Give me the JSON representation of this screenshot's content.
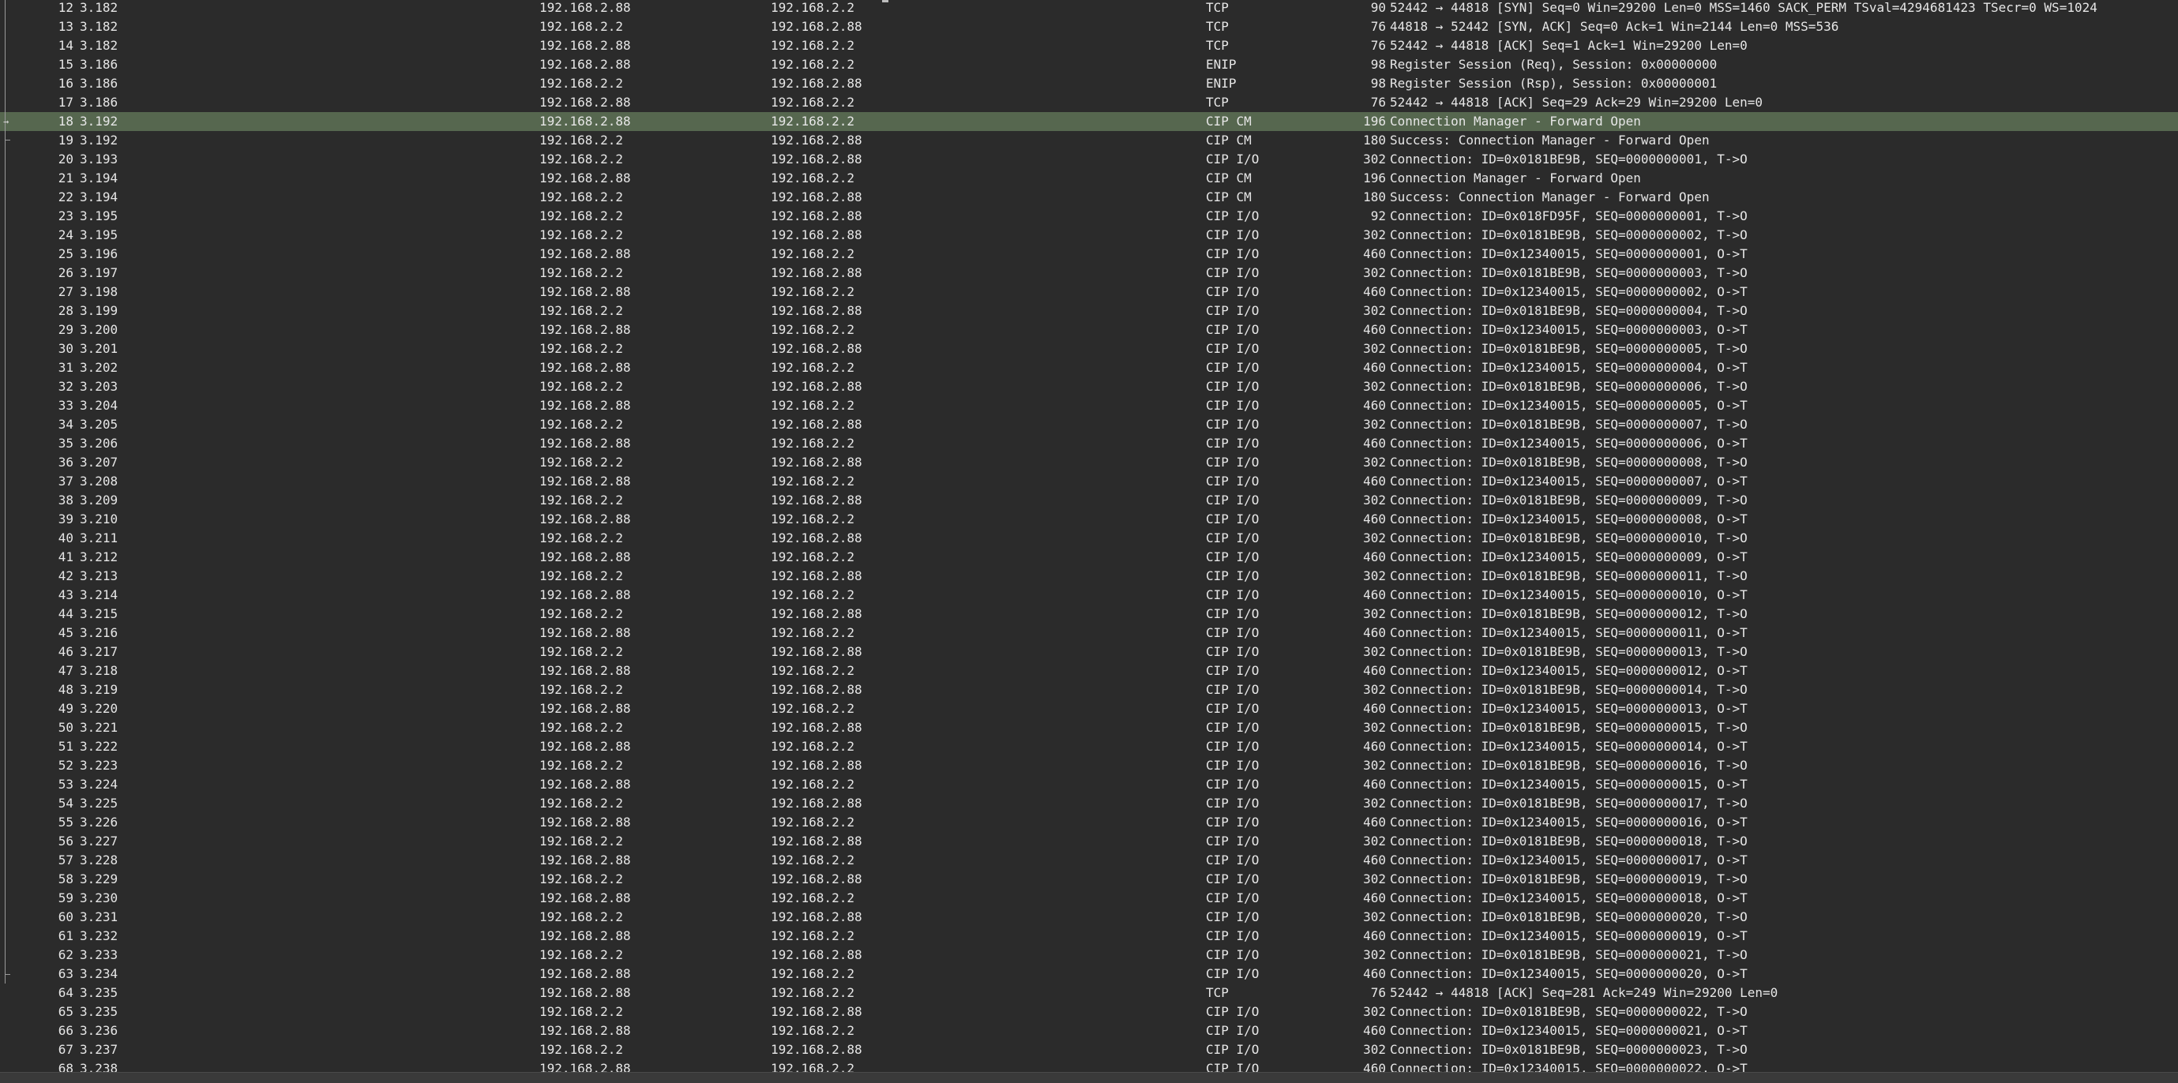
{
  "packets": [
    {
      "no": "12",
      "time": "3.182",
      "src": "192.168.2.88",
      "dst": "192.168.2.2",
      "proto": "TCP",
      "len": "90",
      "info": "52442 → 44818 [SYN] Seq=0 Win=29200 Len=0 MSS=1460 SACK_PERM TSval=4294681423 TSecr=0 WS=1024",
      "selected": false
    },
    {
      "no": "13",
      "time": "3.182",
      "src": "192.168.2.2",
      "dst": "192.168.2.88",
      "proto": "TCP",
      "len": "76",
      "info": "44818 → 52442 [SYN, ACK] Seq=0 Ack=1 Win=2144 Len=0 MSS=536",
      "selected": false
    },
    {
      "no": "14",
      "time": "3.182",
      "src": "192.168.2.88",
      "dst": "192.168.2.2",
      "proto": "TCP",
      "len": "76",
      "info": "52442 → 44818 [ACK] Seq=1 Ack=1 Win=29200 Len=0",
      "selected": false
    },
    {
      "no": "15",
      "time": "3.186",
      "src": "192.168.2.88",
      "dst": "192.168.2.2",
      "proto": "ENIP",
      "len": "98",
      "info": "Register Session (Req), Session: 0x00000000",
      "selected": false
    },
    {
      "no": "16",
      "time": "3.186",
      "src": "192.168.2.2",
      "dst": "192.168.2.88",
      "proto": "ENIP",
      "len": "98",
      "info": "Register Session (Rsp), Session: 0x00000001",
      "selected": false
    },
    {
      "no": "17",
      "time": "3.186",
      "src": "192.168.2.88",
      "dst": "192.168.2.2",
      "proto": "TCP",
      "len": "76",
      "info": "52442 → 44818 [ACK] Seq=29 Ack=29 Win=29200 Len=0",
      "selected": false
    },
    {
      "no": "18",
      "time": "3.192",
      "src": "192.168.2.88",
      "dst": "192.168.2.2",
      "proto": "CIP CM",
      "len": "196",
      "info": "Connection Manager - Forward Open",
      "selected": true
    },
    {
      "no": "19",
      "time": "3.192",
      "src": "192.168.2.2",
      "dst": "192.168.2.88",
      "proto": "CIP CM",
      "len": "180",
      "info": "Success: Connection Manager - Forward Open",
      "selected": false
    },
    {
      "no": "20",
      "time": "3.193",
      "src": "192.168.2.2",
      "dst": "192.168.2.88",
      "proto": "CIP I/O",
      "len": "302",
      "info": "Connection: ID=0x0181BE9B, SEQ=0000000001, T->O",
      "selected": false
    },
    {
      "no": "21",
      "time": "3.194",
      "src": "192.168.2.88",
      "dst": "192.168.2.2",
      "proto": "CIP CM",
      "len": "196",
      "info": "Connection Manager - Forward Open",
      "selected": false
    },
    {
      "no": "22",
      "time": "3.194",
      "src": "192.168.2.2",
      "dst": "192.168.2.88",
      "proto": "CIP CM",
      "len": "180",
      "info": "Success: Connection Manager - Forward Open",
      "selected": false
    },
    {
      "no": "23",
      "time": "3.195",
      "src": "192.168.2.2",
      "dst": "192.168.2.88",
      "proto": "CIP I/O",
      "len": "92",
      "info": "Connection: ID=0x018FD95F, SEQ=0000000001, T->O",
      "selected": false
    },
    {
      "no": "24",
      "time": "3.195",
      "src": "192.168.2.2",
      "dst": "192.168.2.88",
      "proto": "CIP I/O",
      "len": "302",
      "info": "Connection: ID=0x0181BE9B, SEQ=0000000002, T->O",
      "selected": false
    },
    {
      "no": "25",
      "time": "3.196",
      "src": "192.168.2.88",
      "dst": "192.168.2.2",
      "proto": "CIP I/O",
      "len": "460",
      "info": "Connection: ID=0x12340015, SEQ=0000000001, O->T",
      "selected": false
    },
    {
      "no": "26",
      "time": "3.197",
      "src": "192.168.2.2",
      "dst": "192.168.2.88",
      "proto": "CIP I/O",
      "len": "302",
      "info": "Connection: ID=0x0181BE9B, SEQ=0000000003, T->O",
      "selected": false
    },
    {
      "no": "27",
      "time": "3.198",
      "src": "192.168.2.88",
      "dst": "192.168.2.2",
      "proto": "CIP I/O",
      "len": "460",
      "info": "Connection: ID=0x12340015, SEQ=0000000002, O->T",
      "selected": false
    },
    {
      "no": "28",
      "time": "3.199",
      "src": "192.168.2.2",
      "dst": "192.168.2.88",
      "proto": "CIP I/O",
      "len": "302",
      "info": "Connection: ID=0x0181BE9B, SEQ=0000000004, T->O",
      "selected": false
    },
    {
      "no": "29",
      "time": "3.200",
      "src": "192.168.2.88",
      "dst": "192.168.2.2",
      "proto": "CIP I/O",
      "len": "460",
      "info": "Connection: ID=0x12340015, SEQ=0000000003, O->T",
      "selected": false
    },
    {
      "no": "30",
      "time": "3.201",
      "src": "192.168.2.2",
      "dst": "192.168.2.88",
      "proto": "CIP I/O",
      "len": "302",
      "info": "Connection: ID=0x0181BE9B, SEQ=0000000005, T->O",
      "selected": false
    },
    {
      "no": "31",
      "time": "3.202",
      "src": "192.168.2.88",
      "dst": "192.168.2.2",
      "proto": "CIP I/O",
      "len": "460",
      "info": "Connection: ID=0x12340015, SEQ=0000000004, O->T",
      "selected": false
    },
    {
      "no": "32",
      "time": "3.203",
      "src": "192.168.2.2",
      "dst": "192.168.2.88",
      "proto": "CIP I/O",
      "len": "302",
      "info": "Connection: ID=0x0181BE9B, SEQ=0000000006, T->O",
      "selected": false
    },
    {
      "no": "33",
      "time": "3.204",
      "src": "192.168.2.88",
      "dst": "192.168.2.2",
      "proto": "CIP I/O",
      "len": "460",
      "info": "Connection: ID=0x12340015, SEQ=0000000005, O->T",
      "selected": false
    },
    {
      "no": "34",
      "time": "3.205",
      "src": "192.168.2.2",
      "dst": "192.168.2.88",
      "proto": "CIP I/O",
      "len": "302",
      "info": "Connection: ID=0x0181BE9B, SEQ=0000000007, T->O",
      "selected": false
    },
    {
      "no": "35",
      "time": "3.206",
      "src": "192.168.2.88",
      "dst": "192.168.2.2",
      "proto": "CIP I/O",
      "len": "460",
      "info": "Connection: ID=0x12340015, SEQ=0000000006, O->T",
      "selected": false
    },
    {
      "no": "36",
      "time": "3.207",
      "src": "192.168.2.2",
      "dst": "192.168.2.88",
      "proto": "CIP I/O",
      "len": "302",
      "info": "Connection: ID=0x0181BE9B, SEQ=0000000008, T->O",
      "selected": false
    },
    {
      "no": "37",
      "time": "3.208",
      "src": "192.168.2.88",
      "dst": "192.168.2.2",
      "proto": "CIP I/O",
      "len": "460",
      "info": "Connection: ID=0x12340015, SEQ=0000000007, O->T",
      "selected": false
    },
    {
      "no": "38",
      "time": "3.209",
      "src": "192.168.2.2",
      "dst": "192.168.2.88",
      "proto": "CIP I/O",
      "len": "302",
      "info": "Connection: ID=0x0181BE9B, SEQ=0000000009, T->O",
      "selected": false
    },
    {
      "no": "39",
      "time": "3.210",
      "src": "192.168.2.88",
      "dst": "192.168.2.2",
      "proto": "CIP I/O",
      "len": "460",
      "info": "Connection: ID=0x12340015, SEQ=0000000008, O->T",
      "selected": false
    },
    {
      "no": "40",
      "time": "3.211",
      "src": "192.168.2.2",
      "dst": "192.168.2.88",
      "proto": "CIP I/O",
      "len": "302",
      "info": "Connection: ID=0x0181BE9B, SEQ=0000000010, T->O",
      "selected": false
    },
    {
      "no": "41",
      "time": "3.212",
      "src": "192.168.2.88",
      "dst": "192.168.2.2",
      "proto": "CIP I/O",
      "len": "460",
      "info": "Connection: ID=0x12340015, SEQ=0000000009, O->T",
      "selected": false
    },
    {
      "no": "42",
      "time": "3.213",
      "src": "192.168.2.2",
      "dst": "192.168.2.88",
      "proto": "CIP I/O",
      "len": "302",
      "info": "Connection: ID=0x0181BE9B, SEQ=0000000011, T->O",
      "selected": false
    },
    {
      "no": "43",
      "time": "3.214",
      "src": "192.168.2.88",
      "dst": "192.168.2.2",
      "proto": "CIP I/O",
      "len": "460",
      "info": "Connection: ID=0x12340015, SEQ=0000000010, O->T",
      "selected": false
    },
    {
      "no": "44",
      "time": "3.215",
      "src": "192.168.2.2",
      "dst": "192.168.2.88",
      "proto": "CIP I/O",
      "len": "302",
      "info": "Connection: ID=0x0181BE9B, SEQ=0000000012, T->O",
      "selected": false
    },
    {
      "no": "45",
      "time": "3.216",
      "src": "192.168.2.88",
      "dst": "192.168.2.2",
      "proto": "CIP I/O",
      "len": "460",
      "info": "Connection: ID=0x12340015, SEQ=0000000011, O->T",
      "selected": false
    },
    {
      "no": "46",
      "time": "3.217",
      "src": "192.168.2.2",
      "dst": "192.168.2.88",
      "proto": "CIP I/O",
      "len": "302",
      "info": "Connection: ID=0x0181BE9B, SEQ=0000000013, T->O",
      "selected": false
    },
    {
      "no": "47",
      "time": "3.218",
      "src": "192.168.2.88",
      "dst": "192.168.2.2",
      "proto": "CIP I/O",
      "len": "460",
      "info": "Connection: ID=0x12340015, SEQ=0000000012, O->T",
      "selected": false
    },
    {
      "no": "48",
      "time": "3.219",
      "src": "192.168.2.2",
      "dst": "192.168.2.88",
      "proto": "CIP I/O",
      "len": "302",
      "info": "Connection: ID=0x0181BE9B, SEQ=0000000014, T->O",
      "selected": false
    },
    {
      "no": "49",
      "time": "3.220",
      "src": "192.168.2.88",
      "dst": "192.168.2.2",
      "proto": "CIP I/O",
      "len": "460",
      "info": "Connection: ID=0x12340015, SEQ=0000000013, O->T",
      "selected": false
    },
    {
      "no": "50",
      "time": "3.221",
      "src": "192.168.2.2",
      "dst": "192.168.2.88",
      "proto": "CIP I/O",
      "len": "302",
      "info": "Connection: ID=0x0181BE9B, SEQ=0000000015, T->O",
      "selected": false
    },
    {
      "no": "51",
      "time": "3.222",
      "src": "192.168.2.88",
      "dst": "192.168.2.2",
      "proto": "CIP I/O",
      "len": "460",
      "info": "Connection: ID=0x12340015, SEQ=0000000014, O->T",
      "selected": false
    },
    {
      "no": "52",
      "time": "3.223",
      "src": "192.168.2.2",
      "dst": "192.168.2.88",
      "proto": "CIP I/O",
      "len": "302",
      "info": "Connection: ID=0x0181BE9B, SEQ=0000000016, T->O",
      "selected": false
    },
    {
      "no": "53",
      "time": "3.224",
      "src": "192.168.2.88",
      "dst": "192.168.2.2",
      "proto": "CIP I/O",
      "len": "460",
      "info": "Connection: ID=0x12340015, SEQ=0000000015, O->T",
      "selected": false
    },
    {
      "no": "54",
      "time": "3.225",
      "src": "192.168.2.2",
      "dst": "192.168.2.88",
      "proto": "CIP I/O",
      "len": "302",
      "info": "Connection: ID=0x0181BE9B, SEQ=0000000017, T->O",
      "selected": false
    },
    {
      "no": "55",
      "time": "3.226",
      "src": "192.168.2.88",
      "dst": "192.168.2.2",
      "proto": "CIP I/O",
      "len": "460",
      "info": "Connection: ID=0x12340015, SEQ=0000000016, O->T",
      "selected": false
    },
    {
      "no": "56",
      "time": "3.227",
      "src": "192.168.2.2",
      "dst": "192.168.2.88",
      "proto": "CIP I/O",
      "len": "302",
      "info": "Connection: ID=0x0181BE9B, SEQ=0000000018, T->O",
      "selected": false
    },
    {
      "no": "57",
      "time": "3.228",
      "src": "192.168.2.88",
      "dst": "192.168.2.2",
      "proto": "CIP I/O",
      "len": "460",
      "info": "Connection: ID=0x12340015, SEQ=0000000017, O->T",
      "selected": false
    },
    {
      "no": "58",
      "time": "3.229",
      "src": "192.168.2.2",
      "dst": "192.168.2.88",
      "proto": "CIP I/O",
      "len": "302",
      "info": "Connection: ID=0x0181BE9B, SEQ=0000000019, T->O",
      "selected": false
    },
    {
      "no": "59",
      "time": "3.230",
      "src": "192.168.2.88",
      "dst": "192.168.2.2",
      "proto": "CIP I/O",
      "len": "460",
      "info": "Connection: ID=0x12340015, SEQ=0000000018, O->T",
      "selected": false
    },
    {
      "no": "60",
      "time": "3.231",
      "src": "192.168.2.2",
      "dst": "192.168.2.88",
      "proto": "CIP I/O",
      "len": "302",
      "info": "Connection: ID=0x0181BE9B, SEQ=0000000020, T->O",
      "selected": false
    },
    {
      "no": "61",
      "time": "3.232",
      "src": "192.168.2.88",
      "dst": "192.168.2.2",
      "proto": "CIP I/O",
      "len": "460",
      "info": "Connection: ID=0x12340015, SEQ=0000000019, O->T",
      "selected": false
    },
    {
      "no": "62",
      "time": "3.233",
      "src": "192.168.2.2",
      "dst": "192.168.2.88",
      "proto": "CIP I/O",
      "len": "302",
      "info": "Connection: ID=0x0181BE9B, SEQ=0000000021, T->O",
      "selected": false
    },
    {
      "no": "63",
      "time": "3.234",
      "src": "192.168.2.88",
      "dst": "192.168.2.2",
      "proto": "CIP I/O",
      "len": "460",
      "info": "Connection: ID=0x12340015, SEQ=0000000020, O->T",
      "selected": false
    },
    {
      "no": "64",
      "time": "3.235",
      "src": "192.168.2.88",
      "dst": "192.168.2.2",
      "proto": "TCP",
      "len": "76",
      "info": "52442 → 44818 [ACK] Seq=281 Ack=249 Win=29200 Len=0",
      "selected": false
    },
    {
      "no": "65",
      "time": "3.235",
      "src": "192.168.2.2",
      "dst": "192.168.2.88",
      "proto": "CIP I/O",
      "len": "302",
      "info": "Connection: ID=0x0181BE9B, SEQ=0000000022, T->O",
      "selected": false
    },
    {
      "no": "66",
      "time": "3.236",
      "src": "192.168.2.88",
      "dst": "192.168.2.2",
      "proto": "CIP I/O",
      "len": "460",
      "info": "Connection: ID=0x12340015, SEQ=0000000021, O->T",
      "selected": false
    },
    {
      "no": "67",
      "time": "3.237",
      "src": "192.168.2.2",
      "dst": "192.168.2.88",
      "proto": "CIP I/O",
      "len": "302",
      "info": "Connection: ID=0x0181BE9B, SEQ=0000000023, T->O",
      "selected": false
    },
    {
      "no": "68",
      "time": "3.238",
      "src": "192.168.2.88",
      "dst": "192.168.2.2",
      "proto": "CIP I/O",
      "len": "460",
      "info": "Connection: ID=0x12340015, SEQ=0000000022, O->T",
      "selected": false
    }
  ],
  "colors": {
    "background": "#2b2b2b",
    "text": "#e6e6e6",
    "selected_row": "#56674f",
    "gutter_line": "#9a9a9a"
  }
}
